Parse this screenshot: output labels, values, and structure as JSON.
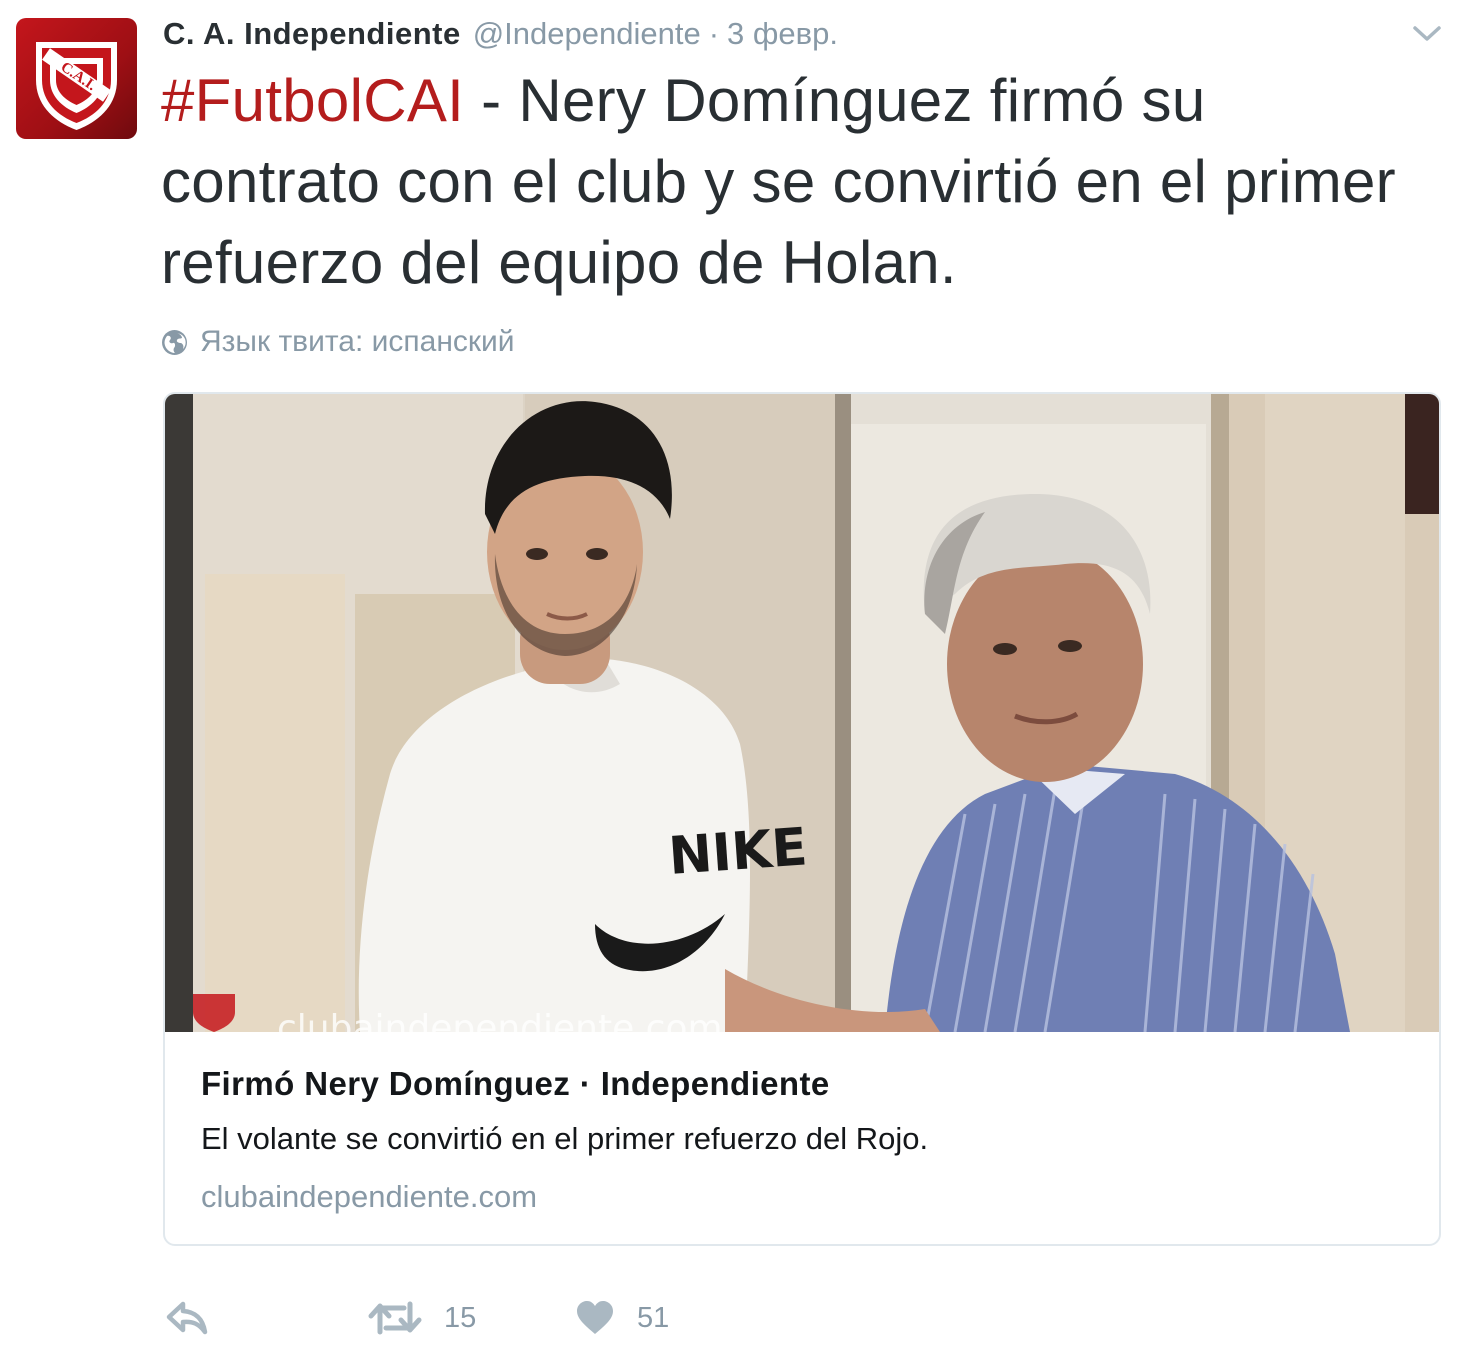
{
  "tweet": {
    "author": {
      "fullname": "C. A. Independiente",
      "username": "@Independiente",
      "avatar_text": "C.A.I."
    },
    "separator": "·",
    "timestamp": "3 февр.",
    "text": {
      "hashtag": "#FutbolCAI",
      "body": " - Nery Domínguez firmó su contrato con el club y se convirtió en el primer refuerzo del equipo de Holan."
    },
    "language_note": "Язык твита: испанский",
    "card": {
      "image_watermark": "clubaindependiente.com",
      "shirt_logo": "NIKE",
      "title": "Firmó Nery Domínguez · Independiente",
      "description": "El volante se convirtió en el primer refuerzo del Rojo.",
      "domain": "clubaindependiente.com"
    },
    "actions": {
      "reply_icon": "reply-icon",
      "retweet_icon": "retweet-icon",
      "retweet_count": "15",
      "like_icon": "heart-icon",
      "like_count": "51"
    }
  },
  "colors": {
    "brand_red": "#b41d1d",
    "avatar_red": "#c4161c",
    "muted_gray": "#8899a6",
    "text_dark": "#292f33",
    "border": "#e1e8ed"
  }
}
